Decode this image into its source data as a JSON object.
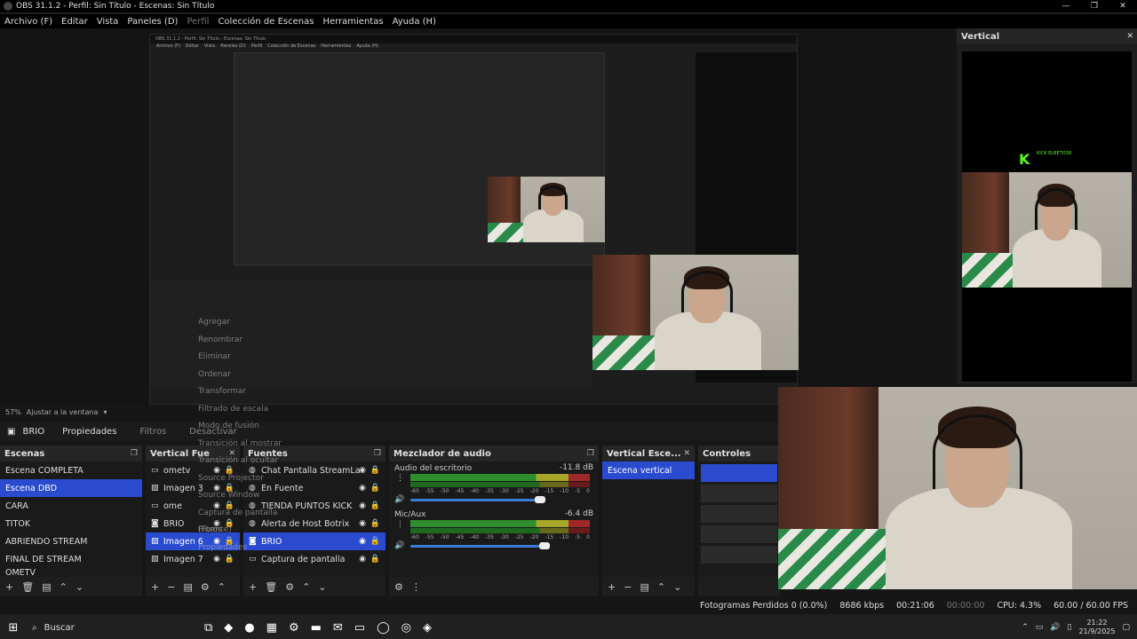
{
  "titlebar": {
    "title": "OBS 31.1.2 - Perfil: Sin Título - Escenas: Sin Título",
    "minimize": "—",
    "restore": "❐",
    "close": "✕"
  },
  "menubar": {
    "items": [
      "Archivo (F)",
      "Editar",
      "Vista",
      "Paneles (D)",
      "Perfil",
      "Colección de Escenas",
      "Herramientas",
      "Ayuda (H)"
    ]
  },
  "vertical_panel": {
    "title": "Vertical",
    "kick_label": "K",
    "kick_text": "KICK\nELBETO38"
  },
  "nested": {
    "title": "OBS 31.1.2 - Perfil: Sin Título - Escenas: Sin Título",
    "menu": [
      "Archivo (F)",
      "Editar",
      "Vista",
      "Paneles (D)",
      "Perfil",
      "Colección de Escenas",
      "Herramientas",
      "Ayuda (H)"
    ]
  },
  "zoom": {
    "value": "57%",
    "fit_label": "Ajustar a la ventana"
  },
  "source_bar": {
    "selected_source": "BRIO",
    "properties": "Propiedades",
    "filters": "Filtros",
    "deactivate": "Desactivar"
  },
  "context_menu": [
    "Agregar",
    "Renombrar",
    "Eliminar",
    "Ordenar",
    "Transformar",
    "Filtrado de escala",
    "Modo de fusión",
    "Transición al mostrar",
    "Transición al ocultar",
    "Source Projector",
    "Source Window",
    "Captura de pantalla (Fuente)",
    "Filtros",
    "Propiedades"
  ],
  "scenes": {
    "title": "Escenas",
    "items": [
      "Escena COMPLETA",
      "Escena DBD",
      "CARA",
      "TITOK",
      "ABRIENDO STREAM",
      "FINAL DE STREAM",
      "OMETV"
    ],
    "selected": 1
  },
  "vertical_sources": {
    "title": "Vertical Fue",
    "items": [
      "ometv",
      "Imagen 3",
      "ome",
      "BRIO",
      "Imagen 6",
      "Imagen 7"
    ]
  },
  "sources": {
    "title": "Fuentes",
    "items": [
      "Chat Pantalla StreamLa",
      "En Fuente",
      "TIENDA PUNTOS KICK",
      "Alerta de Host Botrix",
      "BRIO",
      "Captura de pantalla"
    ],
    "selected": 4
  },
  "mixer": {
    "title": "Mezclador de audio",
    "channels": [
      {
        "name": "Audio del escritorio",
        "db": "-11.8 dB",
        "level": 0.82
      },
      {
        "name": "Mic/Aux",
        "db": "-6.4 dB",
        "level": 0.95
      }
    ],
    "scale": [
      "-60",
      "-55",
      "-50",
      "-45",
      "-40",
      "-35",
      "-30",
      "-25",
      "-20",
      "-15",
      "-10",
      "-5",
      "0"
    ]
  },
  "vertical_scenes": {
    "title": "Vertical Esce...",
    "items": [
      "Escena vertical"
    ]
  },
  "controls": {
    "title": "Controles"
  },
  "status": {
    "dropped": "Fotogramas Perdidos 0 (0.0%)",
    "bitrate": "8686 kbps",
    "stream_time": "00:21:06",
    "rec_time": "00:00:00",
    "cpu": "CPU: 4.3%",
    "fps": "60.00 / 60.00 FPS"
  },
  "taskbar": {
    "search": "Buscar",
    "time": "21:22",
    "date": "21/9/2025"
  },
  "colors": {
    "accent": "#2a4bd0",
    "kick_green": "#53fc18"
  }
}
